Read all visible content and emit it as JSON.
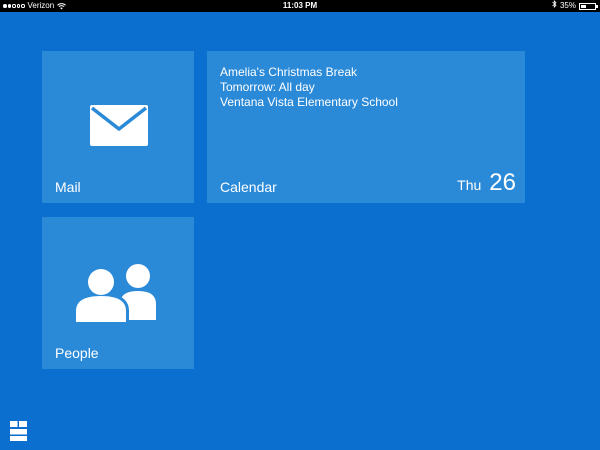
{
  "status_bar": {
    "carrier": "Verizon",
    "time": "11:03 PM",
    "battery": "35%",
    "battery_level": 0.35,
    "signal_bars_filled": 2,
    "signal_bars_total": 5
  },
  "tiles": {
    "mail": {
      "label": "Mail",
      "icon": "envelope-icon"
    },
    "calendar": {
      "label": "Calendar",
      "event_title": "Amelia's Christmas Break",
      "event_time": "Tomorrow: All day",
      "event_location": "Ventana Vista Elementary School",
      "day_name": "Thu",
      "day_number": "26"
    },
    "people": {
      "label": "People",
      "icon": "people-icon"
    }
  },
  "colors": {
    "background": "#0a6fcf",
    "tile": "#2b8ad8",
    "text": "#ffffff"
  }
}
